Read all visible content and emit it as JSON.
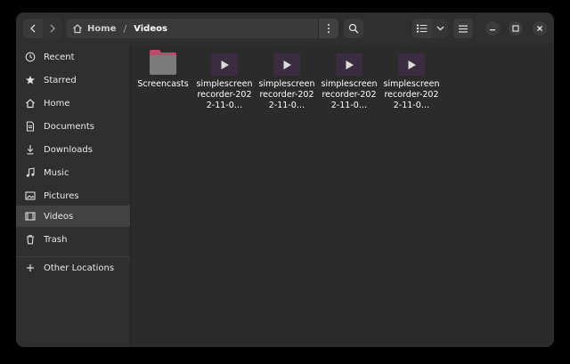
{
  "headerbar": {
    "path": {
      "home_label": "Home",
      "separator": "/",
      "current": "Videos"
    }
  },
  "sidebar": {
    "items": [
      {
        "label": "Recent",
        "icon": "clock-icon"
      },
      {
        "label": "Starred",
        "icon": "star-icon"
      },
      {
        "label": "Home",
        "icon": "home-icon"
      },
      {
        "label": "Documents",
        "icon": "document-icon"
      },
      {
        "label": "Downloads",
        "icon": "download-icon"
      },
      {
        "label": "Music",
        "icon": "music-icon"
      },
      {
        "label": "Pictures",
        "icon": "picture-icon"
      },
      {
        "label": "Videos",
        "icon": "video-icon",
        "active": true
      },
      {
        "label": "Trash",
        "icon": "trash-icon"
      }
    ],
    "other_locations": {
      "label": "Other Locations",
      "icon": "plus-icon"
    }
  },
  "files": [
    {
      "name": "Screencasts",
      "type": "folder"
    },
    {
      "name": "simplescreenrecorder-2022-11-0…",
      "type": "video"
    },
    {
      "name": "simplescreenrecorder-2022-11-0…",
      "type": "video"
    },
    {
      "name": "simplescreenrecorder-2022-11-0…",
      "type": "video"
    },
    {
      "name": "simplescreenrecorder-2022-11-0…",
      "type": "video"
    }
  ],
  "colors": {
    "window_bg": "#2b2b2b",
    "sidebar_bg": "#2f2f2f",
    "active_item_bg": "#424242",
    "folder_body": "#7b7b7b",
    "folder_tab": "#c04a6b",
    "video_thumb": "#3a2d3f"
  }
}
